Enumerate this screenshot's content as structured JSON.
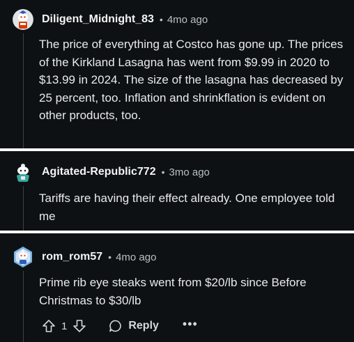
{
  "comments": [
    {
      "username": "Diligent_Midnight_83",
      "separator": "•",
      "time": "4mo ago",
      "avatar_icon": "snoo-avatar-red-icon",
      "text": "The price of everything at Costco has gone up. The prices of the Kirkland Lasagna has went from $9.99 in 2020 to $13.99 in 2024. The size of the lasagna has decreased by 25 percent, too. Inflation and shrinkflation is evident on other products, too."
    },
    {
      "username": "Agitated-Republic772",
      "separator": "•",
      "time": "3mo ago",
      "avatar_icon": "snoo-avatar-teal-icon",
      "text": "Tariffs are having their effect already. One employee told me"
    },
    {
      "username": "rom_rom57",
      "separator": "•",
      "time": "4mo ago",
      "avatar_icon": "snoo-avatar-blue-icon",
      "text": "Prime rib eye steaks went from $20/lb since Before Christmas to $30/lb",
      "vote_count": "1",
      "reply_label": "Reply",
      "more_label": "•••"
    }
  ],
  "colors": {
    "card_background": "#0e1113",
    "text": "#e8eaec",
    "meta": "#b7c1c5",
    "gutter": "#ffffff"
  }
}
